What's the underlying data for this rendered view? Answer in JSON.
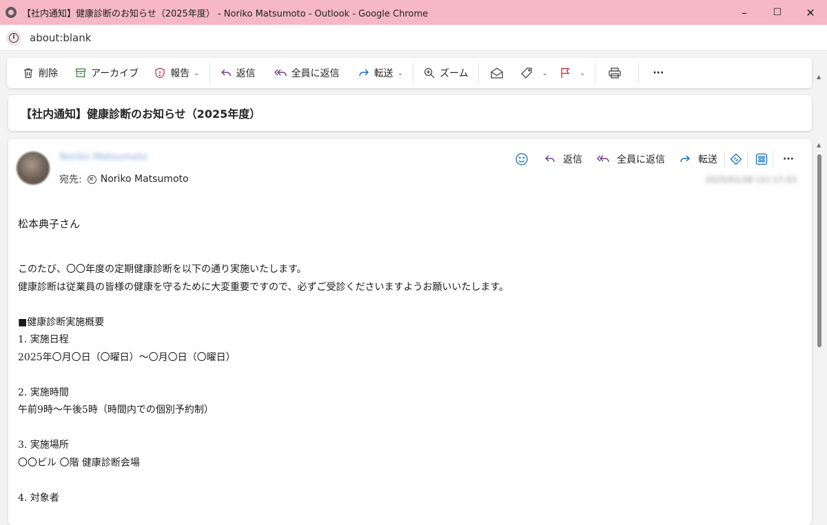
{
  "window": {
    "title": "【社内通知】健康診断のお知らせ（2025年度） - Noriko Matsumoto - Outlook - Google Chrome",
    "minimize": "–",
    "maximize": "☐",
    "close": "✕"
  },
  "addressbar": {
    "url": "about:blank"
  },
  "toolbar": {
    "delete": "削除",
    "archive": "アーカイブ",
    "report": "報告",
    "reply": "返信",
    "reply_all": "全員に返信",
    "forward": "転送",
    "zoom": "ズーム",
    "more": "···"
  },
  "message": {
    "subject": "【社内通知】健康診断のお知らせ（2025年度）",
    "sender_blurred": "Noriko Matsumoto",
    "to_label": "宛先:",
    "to_name": "Noriko Matsumoto",
    "date_blurred": "2025/01/28 (火) 17:53",
    "actions": {
      "reply": "返信",
      "reply_all": "全員に返信",
      "forward": "転送",
      "more": "···"
    },
    "body": {
      "greeting": "松本典子さん",
      "intro1": "このたび、〇〇年度の定期健康診断を以下の通り実施いたします。",
      "intro2": "健康診断は従業員の皆様の健康を守るために大変重要ですので、必ずご受診くださいますようお願いいたします。",
      "overview_heading": "■健康診断実施概要",
      "item1_title": "1. 実施日程",
      "item1_value": "2025年〇月〇日（〇曜日）～〇月〇日（〇曜日）",
      "item2_title": "2. 実施時間",
      "item2_value": "午前9時～午後5時（時間内での個別予約制）",
      "item3_title": "3. 実施場所",
      "item3_value": "〇〇ビル 〇階 健康診断会場",
      "item4_title": "4. 対象者"
    }
  },
  "colors": {
    "titlebar": "#f5b8c4",
    "accent": "#0f6cbd",
    "flag": "#c4314b"
  }
}
